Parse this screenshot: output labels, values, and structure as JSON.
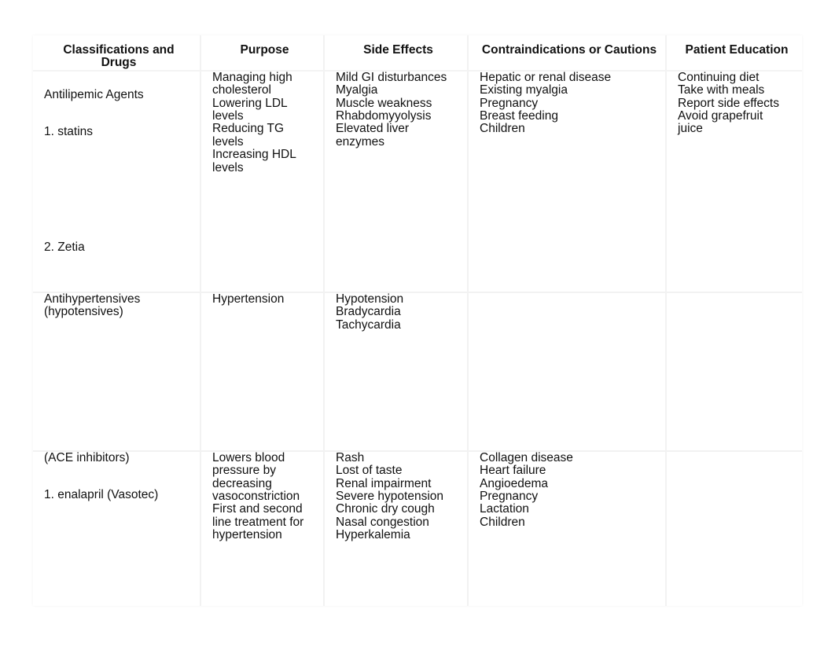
{
  "document": {
    "type": "drug-classification-study-table",
    "columns": [
      "Classifications and Drugs",
      "Purpose",
      "Side Effects",
      "Contraindications or Cautions",
      "Patient Education"
    ],
    "rows": [
      {
        "classification_lines": [
          "Antilipemic Agents",
          "1. statins",
          "2. Zetia"
        ],
        "purpose_lines": [
          "Managing high",
          "cholesterol",
          "Lowering LDL",
          "levels",
          "Reducing TG levels",
          "Increasing HDL",
          "levels"
        ],
        "side_effects_lines": [
          "Mild GI disturbances",
          "Myalgia",
          "Muscle weakness",
          "Rhabdomyyolysis",
          "Elevated liver enzymes"
        ],
        "contraindications_lines": [
          "Hepatic or renal disease",
          "Existing myalgia",
          "Pregnancy",
          "Breast feeding",
          "Children"
        ],
        "patient_education_lines": [
          "Continuing diet",
          "Take with meals",
          "Report side effects",
          "Avoid grapefruit",
          "juice"
        ]
      },
      {
        "classification_lines": [
          "Antihypertensives",
          "(hypotensives)"
        ],
        "purpose_lines": [
          "Hypertension"
        ],
        "side_effects_lines": [
          "Hypotension",
          "Bradycardia",
          "Tachycardia"
        ],
        "contraindications_lines": [],
        "patient_education_lines": []
      },
      {
        "classification_lines": [
          "(ACE inhibitors)",
          "1. enalapril (Vasotec)"
        ],
        "purpose_lines": [
          "Lowers blood",
          "pressure by",
          "decreasing",
          "vasoconstriction",
          "First and second",
          "line treatment for",
          "hypertension"
        ],
        "side_effects_lines": [
          "Rash",
          "Lost of taste",
          "Renal impairment",
          "Severe hypotension",
          "Chronic dry cough",
          "Nasal congestion",
          "Hyperkalemia"
        ],
        "contraindications_lines": [
          "Collagen disease",
          "Heart failure",
          "Angioedema",
          "Pregnancy",
          "Lactation",
          "Children"
        ],
        "patient_education_lines": []
      }
    ]
  },
  "colors": {
    "page_background": "#ffffff",
    "text": "#111111",
    "cell_border": "#f2f2f2"
  }
}
